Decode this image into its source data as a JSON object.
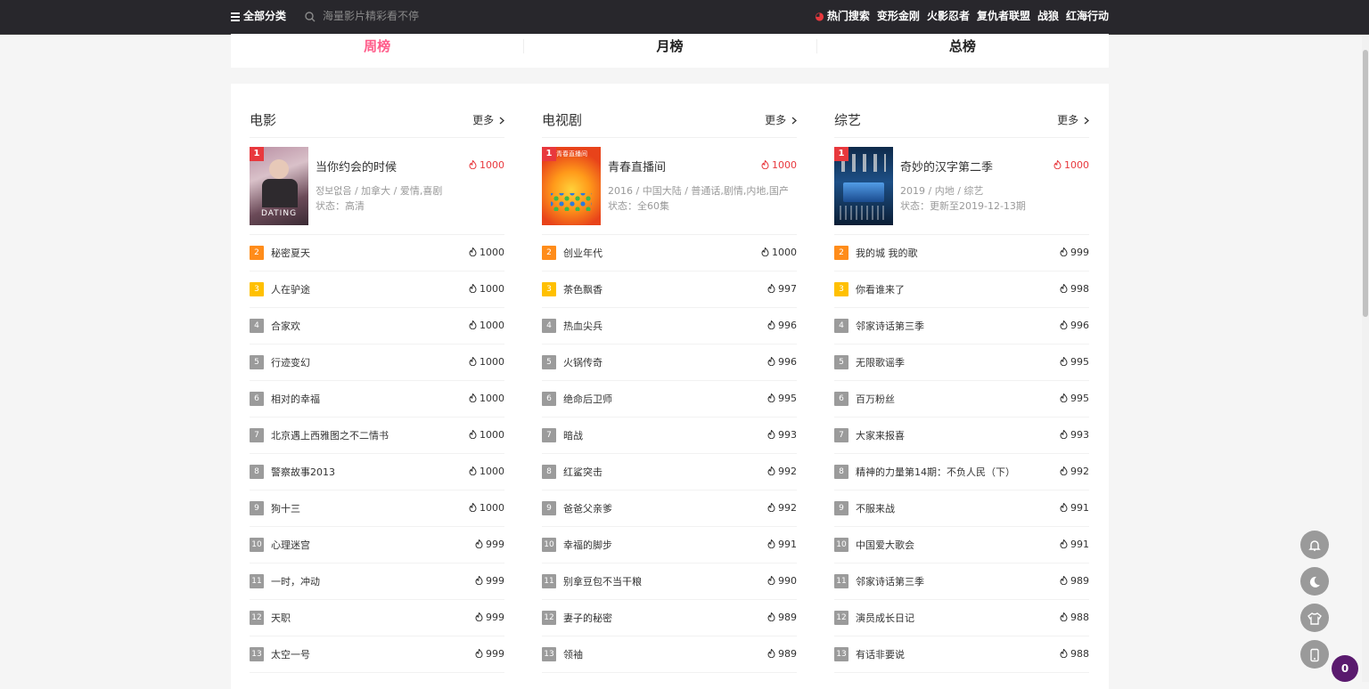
{
  "header": {
    "all_categories": "全部分类",
    "search_placeholder": "海量影片精彩看不停",
    "hot_label": "热门搜索",
    "hot_keywords": [
      "变形金刚",
      "火影忍者",
      "复仇者联盟",
      "战狼",
      "红海行动"
    ]
  },
  "tabs": [
    {
      "label": "周榜",
      "active": true
    },
    {
      "label": "月榜",
      "active": false
    },
    {
      "label": "总榜",
      "active": false
    }
  ],
  "more_label": "更多",
  "columns": [
    {
      "title": "电影",
      "top": {
        "rank": "1",
        "name": "当你约会的时候",
        "heat": "1000",
        "meta": "정보없음 / 加拿大 / 爱情,喜剧",
        "status": "状态：高清",
        "poster_text": "DATING"
      },
      "items": [
        {
          "rank": "2",
          "name": "秘密夏天",
          "heat": "1000"
        },
        {
          "rank": "3",
          "name": "人在驴途",
          "heat": "1000"
        },
        {
          "rank": "4",
          "name": "合家欢",
          "heat": "1000"
        },
        {
          "rank": "5",
          "name": "行迹变幻",
          "heat": "1000"
        },
        {
          "rank": "6",
          "name": "相对的幸福",
          "heat": "1000"
        },
        {
          "rank": "7",
          "name": "北京遇上西雅图之不二情书",
          "heat": "1000"
        },
        {
          "rank": "8",
          "name": "警察故事2013",
          "heat": "1000"
        },
        {
          "rank": "9",
          "name": "狗十三",
          "heat": "1000"
        },
        {
          "rank": "10",
          "name": "心理迷宫",
          "heat": "999"
        },
        {
          "rank": "11",
          "name": "一时，冲动",
          "heat": "999"
        },
        {
          "rank": "12",
          "name": "天职",
          "heat": "999"
        },
        {
          "rank": "13",
          "name": "太空一号",
          "heat": "999"
        }
      ]
    },
    {
      "title": "电视剧",
      "top": {
        "rank": "1",
        "name": "青春直播间",
        "heat": "1000",
        "meta": "2016 / 中国大陆 / 普通话,剧情,内地,国产",
        "status": "状态：全60集",
        "poster_text": "青春直播间"
      },
      "items": [
        {
          "rank": "2",
          "name": "创业年代",
          "heat": "1000"
        },
        {
          "rank": "3",
          "name": "茶色飘香",
          "heat": "997"
        },
        {
          "rank": "4",
          "name": "热血尖兵",
          "heat": "996"
        },
        {
          "rank": "5",
          "name": "火锅传奇",
          "heat": "996"
        },
        {
          "rank": "6",
          "name": "绝命后卫师",
          "heat": "995"
        },
        {
          "rank": "7",
          "name": "暗战",
          "heat": "993"
        },
        {
          "rank": "8",
          "name": "红鲨突击",
          "heat": "992"
        },
        {
          "rank": "9",
          "name": "爸爸父亲爹",
          "heat": "992"
        },
        {
          "rank": "10",
          "name": "幸福的脚步",
          "heat": "991"
        },
        {
          "rank": "11",
          "name": "别拿豆包不当干粮",
          "heat": "990"
        },
        {
          "rank": "12",
          "name": "妻子的秘密",
          "heat": "989"
        },
        {
          "rank": "13",
          "name": "领袖",
          "heat": "989"
        }
      ]
    },
    {
      "title": "综艺",
      "top": {
        "rank": "1",
        "name": "奇妙的汉字第二季",
        "heat": "1000",
        "meta": "2019 / 内地 / 综艺",
        "status": "状态：更新至2019-12-13期",
        "poster_text": ""
      },
      "items": [
        {
          "rank": "2",
          "name": "我的城 我的歌",
          "heat": "999"
        },
        {
          "rank": "3",
          "name": "你看谁来了",
          "heat": "998"
        },
        {
          "rank": "4",
          "name": "邻家诗话第三季",
          "heat": "996"
        },
        {
          "rank": "5",
          "name": "无限歌谣季",
          "heat": "995"
        },
        {
          "rank": "6",
          "name": "百万粉丝",
          "heat": "995"
        },
        {
          "rank": "7",
          "name": "大家来报喜",
          "heat": "993"
        },
        {
          "rank": "8",
          "name": "精神的力量第14期：不负人民（下）",
          "heat": "992"
        },
        {
          "rank": "9",
          "name": "不服来战",
          "heat": "991"
        },
        {
          "rank": "10",
          "name": "中国爱大歌会",
          "heat": "991"
        },
        {
          "rank": "11",
          "name": "邻家诗话第三季",
          "heat": "989"
        },
        {
          "rank": "12",
          "name": "演员成长日记",
          "heat": "988"
        },
        {
          "rank": "13",
          "name": "有话非要说",
          "heat": "988"
        }
      ]
    }
  ],
  "side_buttons": [
    "bell-icon",
    "moon-icon",
    "shirt-icon",
    "phone-icon"
  ],
  "badge_count": "0",
  "colors": {
    "accent": "#ff5c8a",
    "rank1": "#e8383d",
    "rank2": "#ff8c1a",
    "rank3": "#ffc000",
    "rank_other": "#9b9b9b",
    "header_bg": "#28272c"
  }
}
